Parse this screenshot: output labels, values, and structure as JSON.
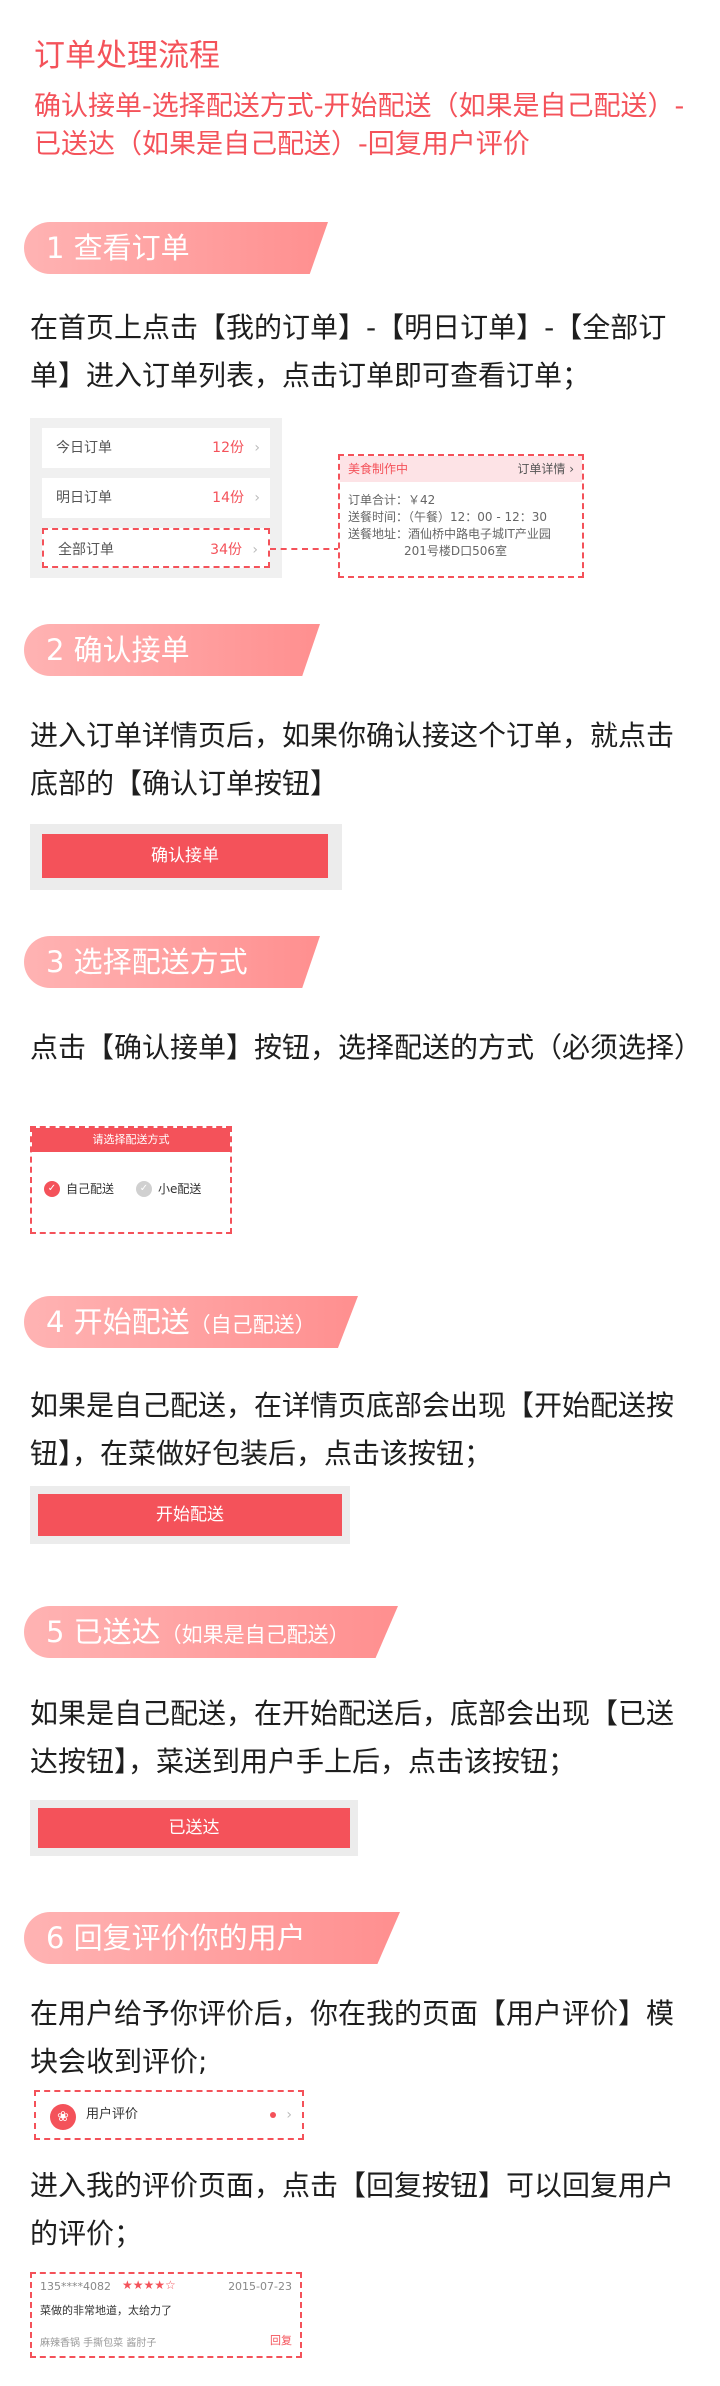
{
  "page": {
    "title": "订单处理流程",
    "flow": "确认接单-选择配送方式-开始配送（如果是自己配送）-已送达（如果是自己配送）-回复用户评价"
  },
  "steps": [
    {
      "label": "1  查看订单",
      "note": ""
    },
    {
      "label": "2  确认接单",
      "note": ""
    },
    {
      "label": "3  选择配送方式",
      "note": ""
    },
    {
      "label": "4  开始配送",
      "note": "（自己配送）"
    },
    {
      "label": "5  已送达",
      "note": "（如果是自己配送）"
    },
    {
      "label": "6  回复评价你的用户",
      "note": ""
    }
  ],
  "paragraphs": {
    "view": "在首页上点击【我的订单】-【明日订单】-【全部订单】进入订单列表，点击订单即可查看订单；",
    "confirm": "进入订单详情页后，如果你确认接这个订单，就点击底部的【确认订单按钮】",
    "choose": "点击【确认接单】按钮，选择配送的方式（必须选择）",
    "start": "如果是自己配送，在详情页底部会出现【开始配送按钮】，在菜做好包装后，点击该按钮；",
    "arrived": "如果是自己配送，在开始配送后，底部会出现【已送达按钮】，菜送到用户手上后，点击该按钮；",
    "reviews": "在用户给予你评价后，你在我的页面【用户评价】模块会收到评价;",
    "reply": "进入我的评价页面，点击【回复按钮】可以回复用户的评价；"
  },
  "orders": {
    "rows": [
      {
        "label": "今日订单",
        "count": "12份"
      },
      {
        "label": "明日订单",
        "count": "14份"
      },
      {
        "label": "全部订单",
        "count": "34份"
      }
    ],
    "chevron": "›"
  },
  "detail": {
    "status": "美食制作中",
    "link": "订单详情 ›",
    "total": "订单合计：￥42",
    "time": "送餐时间：（午餐）12：00 - 12：30",
    "addr1": "送餐地址：酒仙桥中路电子城IT产业园",
    "addr2": "201号楼D口506室"
  },
  "buttons": {
    "confirm": "确认接单",
    "start": "开始配送",
    "arrived": "已送达"
  },
  "delivery": {
    "header": "请选择配送方式",
    "self": "自己配送",
    "xiaoe": "小e配送"
  },
  "review_entry": {
    "label": "用户评价",
    "avatar_icon": "❀"
  },
  "review": {
    "user": "135****4082",
    "stars": "★★★★☆",
    "date": "2015-07-23",
    "text": "菜做的非常地道，太给力了",
    "dishes": "麻辣香锅  手撕包菜  酱肘子",
    "reply": "回复"
  },
  "colors": {
    "accent": "#f4525a"
  }
}
